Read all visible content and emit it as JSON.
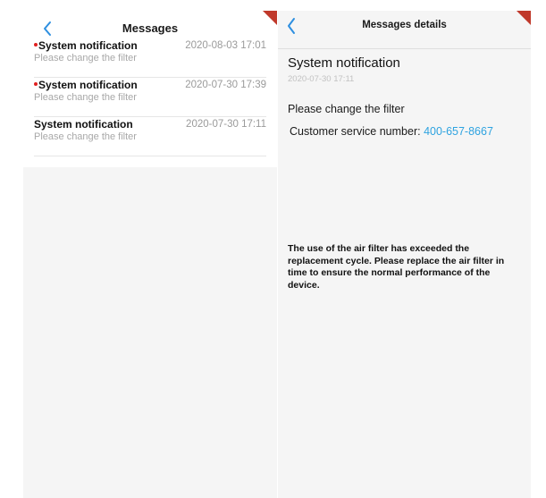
{
  "messages_screen": {
    "title": "Messages",
    "items": [
      {
        "unread": true,
        "title": "System notification",
        "time": "2020-08-03 17:01",
        "subtitle": "Please change the filter"
      },
      {
        "unread": true,
        "title": "System notification",
        "time": "2020-07-30 17:39",
        "subtitle": "Please change the filter"
      },
      {
        "unread": false,
        "title": "System notification",
        "time": "2020-07-30 17:11",
        "subtitle": "Please change the filter"
      }
    ]
  },
  "details_screen": {
    "title": "Messages details",
    "notification_title": "System notification",
    "date": "2020-07-30 17:11",
    "body": "Please change the filter",
    "service_label": "Customer service number:",
    "service_phone": "400-657-8667",
    "description": "The use of the air filter has exceeded the replacement cycle. Please replace the air filter in time to ensure the normal performance of the device."
  },
  "colors": {
    "accent_blue": "#2ea3e0",
    "unread_dot": "#e02020",
    "corner_ribbon": "#c0392b"
  },
  "icons": {
    "back": "chevron-left-icon"
  }
}
